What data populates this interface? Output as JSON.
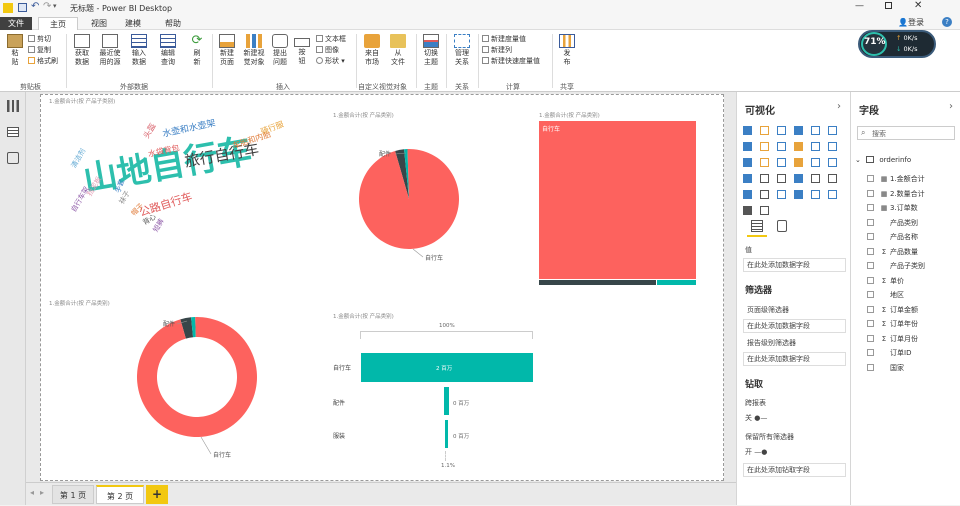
{
  "app": {
    "title": "无标题 - Power BI Desktop",
    "signin": "登录"
  },
  "tabs": [
    "文件",
    "主页",
    "视图",
    "建模",
    "帮助"
  ],
  "ribbon": {
    "clipboard": {
      "paste": "粘\n贴",
      "cut": "剪切",
      "copy": "复制",
      "format_painter": "格式刷",
      "group": "剪贴板"
    },
    "external": {
      "get_data": "获取\n数据",
      "recent": "最近使\n用的源",
      "enter_data": "输入\n数据",
      "edit_queries": "编辑\n查询",
      "refresh": "刷\n新",
      "group": "外部数据"
    },
    "insert": {
      "new_page": "新建\n页面",
      "new_visual": "新建视\n觉对象",
      "ask": "提出\n问题",
      "buttons": "按\n钮",
      "textbox": "文本框",
      "image": "图像",
      "shapes": "形状",
      "group": "插入"
    },
    "custom": {
      "marketplace": "来自\n市场",
      "from_file": "从\n文件",
      "group": "自定义视觉对象"
    },
    "theme": {
      "switch": "切换\n主题",
      "group": "主题"
    },
    "rel": {
      "manage": "管理\n关系",
      "group": "关系"
    },
    "calc": {
      "new_measure": "新建度量值",
      "new_column": "新建列",
      "new_quick_measure": "新建快速度量值",
      "group": "计算"
    },
    "share": {
      "publish": "发\n布",
      "group": "共享"
    }
  },
  "gauge": {
    "pct": "71%",
    "up": "0K/s",
    "down": "0K/s"
  },
  "visuals": {
    "wordcloud": {
      "title": "1.金额合计(按 产品子类别)",
      "words": [
        {
          "t": "山地自行车",
          "c": "#2dbfad"
        },
        {
          "t": "旅行自行车",
          "c": "#404040"
        },
        {
          "t": "公路自行车",
          "c": "#e05a5a"
        },
        {
          "t": "水壶和水壶架",
          "c": "#3b7fc4"
        },
        {
          "t": "车胎和内胎",
          "c": "#e07b39"
        },
        {
          "t": "骑行服",
          "c": "#e8a33b"
        },
        {
          "t": "水袋背包",
          "c": "#e05a5a"
        },
        {
          "t": "头盔",
          "c": "#d9646e"
        },
        {
          "t": "清洁剂",
          "c": "#5fa8d3"
        },
        {
          "t": "挡泥板",
          "c": "#e39bb2"
        },
        {
          "t": "自行车架",
          "c": "#8e5aa8"
        },
        {
          "t": "袜子",
          "c": "#8a8a8a"
        },
        {
          "t": "帽子",
          "c": "#e07b39"
        },
        {
          "t": "背心",
          "c": "#555555"
        },
        {
          "t": "手套",
          "c": "#3b7fc4"
        },
        {
          "t": "短裤",
          "c": "#8e5aa8"
        }
      ]
    },
    "pie": {
      "title": "1.金额合计(按 产品类别)",
      "label1": "配件",
      "label2": "自行车"
    },
    "treemap": {
      "title": "1.金额合计(按 产品类别)",
      "label": "自行车"
    },
    "donut": {
      "title": "1.金额合计(按 产品类别)",
      "label1": "配件",
      "label2": "自行车"
    },
    "funnel": {
      "title": "1.金额合计(按 产品类别)",
      "top": "100%",
      "bottom": "1.1%",
      "rows": [
        {
          "cat": "自行车",
          "val": "2 百万"
        },
        {
          "cat": "配件",
          "val": "0 百万"
        },
        {
          "cat": "服装",
          "val": "0 百万"
        }
      ]
    }
  },
  "chart_data": [
    {
      "type": "pie",
      "title": "1.金额合计(按 产品类别)",
      "categories": [
        "自行车",
        "配件",
        "服装"
      ],
      "values": [
        96.0,
        2.9,
        1.1
      ]
    },
    {
      "type": "pie",
      "title": "1.金额合计(按 产品类别)",
      "categories": [
        "自行车",
        "配件",
        "服装"
      ],
      "values": [
        96.0,
        2.9,
        1.1
      ]
    }
  ],
  "colors": {
    "red": "#fd625e",
    "dark": "#374649",
    "teal": "#01b8aa",
    "gray": "#8ad4eb",
    "accent": "#f2c811"
  },
  "pages": {
    "p1": "第 1 页",
    "p2": "第 2 页",
    "add": "+"
  },
  "viz_pane": {
    "title": "可视化",
    "values": "值",
    "values_well": "在此处添加数据字段",
    "filters": "筛选器",
    "page_filter": "页面级筛选器",
    "page_well": "在此处添加数据字段",
    "report_filter": "报告级别筛选器",
    "report_well": "在此处添加数据字段",
    "drill": "钻取",
    "cross_report": "跨报表",
    "off": "关",
    "keep_filters": "保留所有筛选器",
    "on": "开",
    "drill_well": "在此处添加钻取字段"
  },
  "fields_pane": {
    "title": "字段",
    "search": "搜索",
    "table": "orderinfo",
    "fields": [
      {
        "sg": "▦",
        "n": "1.金额合计"
      },
      {
        "sg": "▦",
        "n": "2.数量合计"
      },
      {
        "sg": "▦",
        "n": "3.订单数"
      },
      {
        "sg": "",
        "n": "产品类别"
      },
      {
        "sg": "",
        "n": "产品名称"
      },
      {
        "sg": "Σ",
        "n": "产品数量"
      },
      {
        "sg": "",
        "n": "产品子类别"
      },
      {
        "sg": "Σ",
        "n": "单价"
      },
      {
        "sg": "",
        "n": "地区"
      },
      {
        "sg": "Σ",
        "n": "订单金额"
      },
      {
        "sg": "Σ",
        "n": "订单年份"
      },
      {
        "sg": "Σ",
        "n": "订单月份"
      },
      {
        "sg": "",
        "n": "订单ID"
      },
      {
        "sg": "",
        "n": "国家"
      }
    ]
  }
}
